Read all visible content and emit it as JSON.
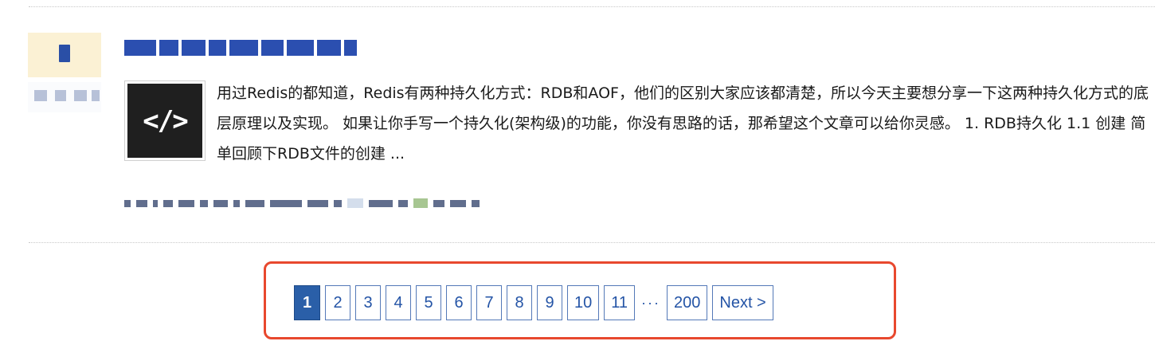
{
  "post": {
    "thumbnail_glyph": "</>",
    "summary": "用过Redis的都知道，Redis有两种持久化方式：RDB和AOF，他们的区别大家应该都清楚，所以今天主要想分享一下这两种持久化方式的底层原理以及实现。 如果让你手写一个持久化(架构级)的功能，你没有思路的话，那希望这个文章可以给你灵感。 1. RDB持久化 1.1 创建 简单回顾下RDB文件的创建 ..."
  },
  "pagination": {
    "pages": [
      "1",
      "2",
      "3",
      "4",
      "5",
      "6",
      "7",
      "8",
      "9",
      "10",
      "11"
    ],
    "current": "1",
    "ellipsis": "···",
    "last": "200",
    "next_label": "Next >"
  },
  "colors": {
    "accent": "#2a5fa8",
    "highlight_border": "#e8482e"
  }
}
